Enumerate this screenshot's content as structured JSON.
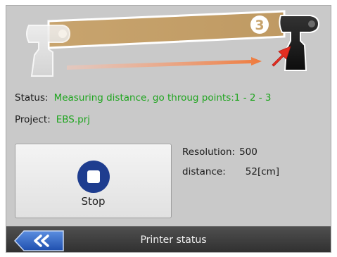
{
  "status": {
    "label": "Status:",
    "value": "Measuring distance, go throug points:1 - 2 - 3"
  },
  "project": {
    "label": "Project:",
    "value": "EBS.prj"
  },
  "stop_button": {
    "label": "Stop"
  },
  "resolution": {
    "label": "Resolution:",
    "value": "500"
  },
  "distance": {
    "label": "distance:",
    "value": "52[cm]"
  },
  "illustration": {
    "step_number": "3"
  },
  "bottom_bar": {
    "title": "Printer status",
    "back_icon": "double-chevron-left-icon"
  },
  "colors": {
    "status_green": "#1fa51f",
    "stop_blue": "#1e3d8f",
    "back_blue": "#2d64c8",
    "beam_tan": "#c8a46e"
  }
}
